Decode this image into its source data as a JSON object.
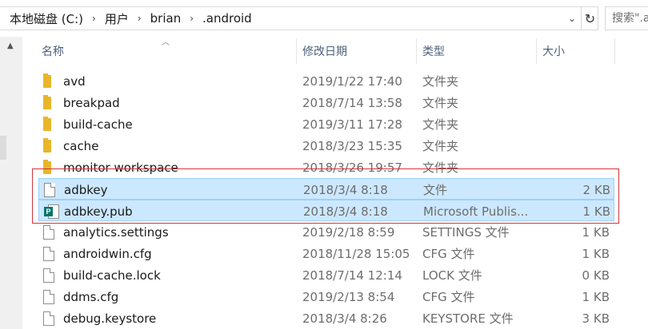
{
  "address_bar": {
    "crumbs": [
      "本地磁盘 (C:)",
      "用户",
      "brian",
      ".android"
    ],
    "separator": "›",
    "dropdown_glyph": "⌄",
    "refresh_glyph": "↻"
  },
  "search": {
    "placeholder": "搜索\".android\""
  },
  "columns": {
    "name": "名称",
    "modified": "修改日期",
    "type": "类型",
    "size": "大小"
  },
  "files": [
    {
      "name": "avd",
      "modified": "2019/1/22 17:40",
      "type": "文件夹",
      "size": "",
      "icon": "folder-icon",
      "selected": false
    },
    {
      "name": "breakpad",
      "modified": "2018/7/14 13:58",
      "type": "文件夹",
      "size": "",
      "icon": "folder-icon",
      "selected": false
    },
    {
      "name": "build-cache",
      "modified": "2019/3/11 17:28",
      "type": "文件夹",
      "size": "",
      "icon": "folder-icon",
      "selected": false
    },
    {
      "name": "cache",
      "modified": "2018/3/23 15:35",
      "type": "文件夹",
      "size": "",
      "icon": "folder-icon",
      "selected": false
    },
    {
      "name": "monitor workspace",
      "modified": "2018/3/26 19:57",
      "type": "文件夹",
      "size": "",
      "icon": "folder-icon",
      "selected": false
    },
    {
      "name": "adbkey",
      "modified": "2018/3/4 8:18",
      "type": "文件",
      "size": "2 KB",
      "icon": "file-icon",
      "selected": true
    },
    {
      "name": "adbkey.pub",
      "modified": "2018/3/4 8:18",
      "type": "Microsoft Publis...",
      "size": "1 KB",
      "icon": "publisher-file-icon",
      "selected": true
    },
    {
      "name": "analytics.settings",
      "modified": "2019/2/18 8:59",
      "type": "SETTINGS 文件",
      "size": "1 KB",
      "icon": "file-icon",
      "selected": false
    },
    {
      "name": "androidwin.cfg",
      "modified": "2018/11/28 15:05",
      "type": "CFG 文件",
      "size": "1 KB",
      "icon": "file-icon",
      "selected": false
    },
    {
      "name": "build-cache.lock",
      "modified": "2018/7/14 12:14",
      "type": "LOCK 文件",
      "size": "0 KB",
      "icon": "file-icon",
      "selected": false
    },
    {
      "name": "ddms.cfg",
      "modified": "2019/2/13 8:54",
      "type": "CFG 文件",
      "size": "1 KB",
      "icon": "file-icon",
      "selected": false
    },
    {
      "name": "debug.keystore",
      "modified": "2018/3/4 8:26",
      "type": "KEYSTORE 文件",
      "size": "3 KB",
      "icon": "file-icon",
      "selected": false
    }
  ],
  "colors": {
    "selection_bg": "#cce8ff",
    "selection_border": "#99d1ff",
    "annotation_red": "#d0353a",
    "folder_yellow": "#e8b62b",
    "publisher_teal": "#077568"
  }
}
